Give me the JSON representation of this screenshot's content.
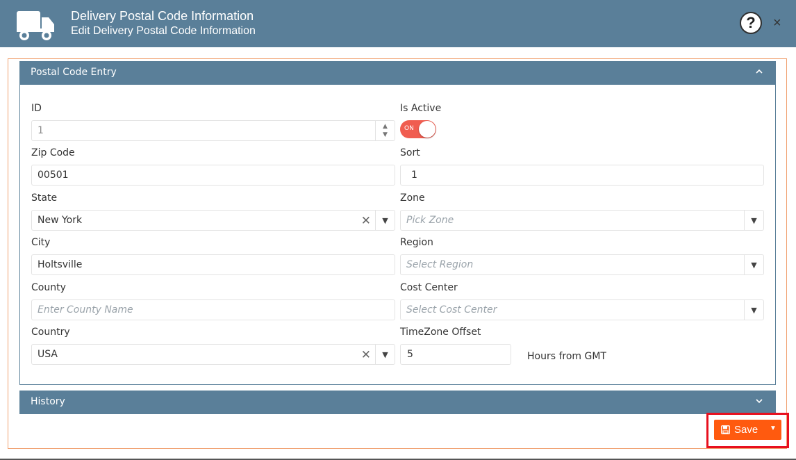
{
  "header": {
    "title": "Delivery Postal Code Information",
    "subtitle": "Edit Delivery Postal Code Information",
    "help_glyph": "?",
    "close_glyph": "×"
  },
  "panels": {
    "entry_title": "Postal Code Entry",
    "history_title": "History"
  },
  "form": {
    "id": {
      "label": "ID",
      "value": "1"
    },
    "is_active": {
      "label": "Is Active",
      "state": "ON"
    },
    "zip": {
      "label": "Zip Code",
      "value": "00501"
    },
    "sort": {
      "label": "Sort",
      "value": "1"
    },
    "state": {
      "label": "State",
      "value": "New York"
    },
    "zone": {
      "label": "Zone",
      "placeholder": "Pick Zone"
    },
    "city": {
      "label": "City",
      "value": "Holtsville"
    },
    "region": {
      "label": "Region",
      "placeholder": "Select Region"
    },
    "county": {
      "label": "County",
      "placeholder": "Enter County Name"
    },
    "cost_center": {
      "label": "Cost Center",
      "placeholder": "Select Cost Center"
    },
    "country": {
      "label": "Country",
      "value": "USA"
    },
    "timezone": {
      "label": "TimeZone Offset",
      "value": "5",
      "suffix": "Hours from GMT"
    }
  },
  "footer": {
    "save_label": "Save"
  },
  "icons": {
    "header": "truck-icon",
    "help": "question-circle-icon",
    "close": "close-icon",
    "collapse": "chevron-up-icon",
    "expand": "chevron-down-icon",
    "save": "floppy-disk-icon"
  },
  "colors": {
    "header_bg": "#5a7f99",
    "accent_orange": "#ff5a0f",
    "toggle_on": "#f05d50",
    "highlight": "#e8101e"
  }
}
